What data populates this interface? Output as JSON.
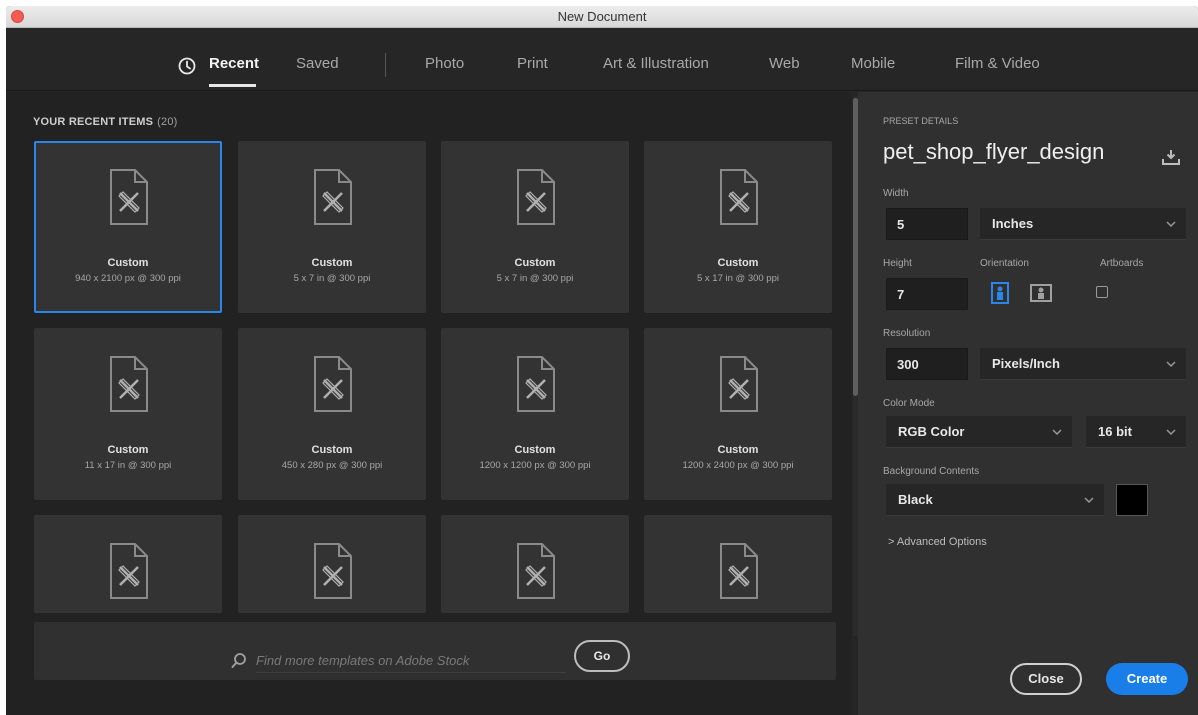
{
  "window": {
    "title": "New Document"
  },
  "tabs": [
    {
      "label": "Recent",
      "active": true
    },
    {
      "label": "Saved"
    },
    {
      "label": "Photo"
    },
    {
      "label": "Print"
    },
    {
      "label": "Art & Illustration"
    },
    {
      "label": "Web"
    },
    {
      "label": "Mobile"
    },
    {
      "label": "Film & Video"
    }
  ],
  "recent": {
    "title": "YOUR RECENT ITEMS",
    "count": "(20)",
    "items": [
      {
        "name": "Custom",
        "desc": "940 x 2100 px @ 300 ppi",
        "selected": true
      },
      {
        "name": "Custom",
        "desc": "5 x 7 in @ 300 ppi"
      },
      {
        "name": "Custom",
        "desc": "5 x 7 in @ 300 ppi"
      },
      {
        "name": "Custom",
        "desc": "5 x 17 in @ 300 ppi"
      },
      {
        "name": "Custom",
        "desc": "11 x 17 in @ 300 ppi"
      },
      {
        "name": "Custom",
        "desc": "450 x 280 px @ 300 ppi"
      },
      {
        "name": "Custom",
        "desc": "1200 x 1200 px @ 300 ppi"
      },
      {
        "name": "Custom",
        "desc": "1200 x 2400 px @ 300 ppi"
      }
    ]
  },
  "stock": {
    "placeholder": "Find more templates on Adobe Stock",
    "go_label": "Go"
  },
  "preset": {
    "section_label": "PRESET DETAILS",
    "name": "pet_shop_flyer_design",
    "width_label": "Width",
    "width_value": "5",
    "width_unit": "Inches",
    "height_label": "Height",
    "height_value": "7",
    "orientation_label": "Orientation",
    "artboards_label": "Artboards",
    "resolution_label": "Resolution",
    "resolution_value": "300",
    "resolution_unit": "Pixels/Inch",
    "color_mode_label": "Color Mode",
    "color_mode": "RGB Color",
    "bit_depth": "16 bit",
    "background_label": "Background Contents",
    "background": "Black",
    "background_swatch": "#000000",
    "advanced_label": "> Advanced Options"
  },
  "footer": {
    "close_label": "Close",
    "create_label": "Create"
  },
  "colors": {
    "accent": "#1a7ee8",
    "selection": "#2b86ea",
    "panel": "#303030",
    "background": "#222222"
  }
}
